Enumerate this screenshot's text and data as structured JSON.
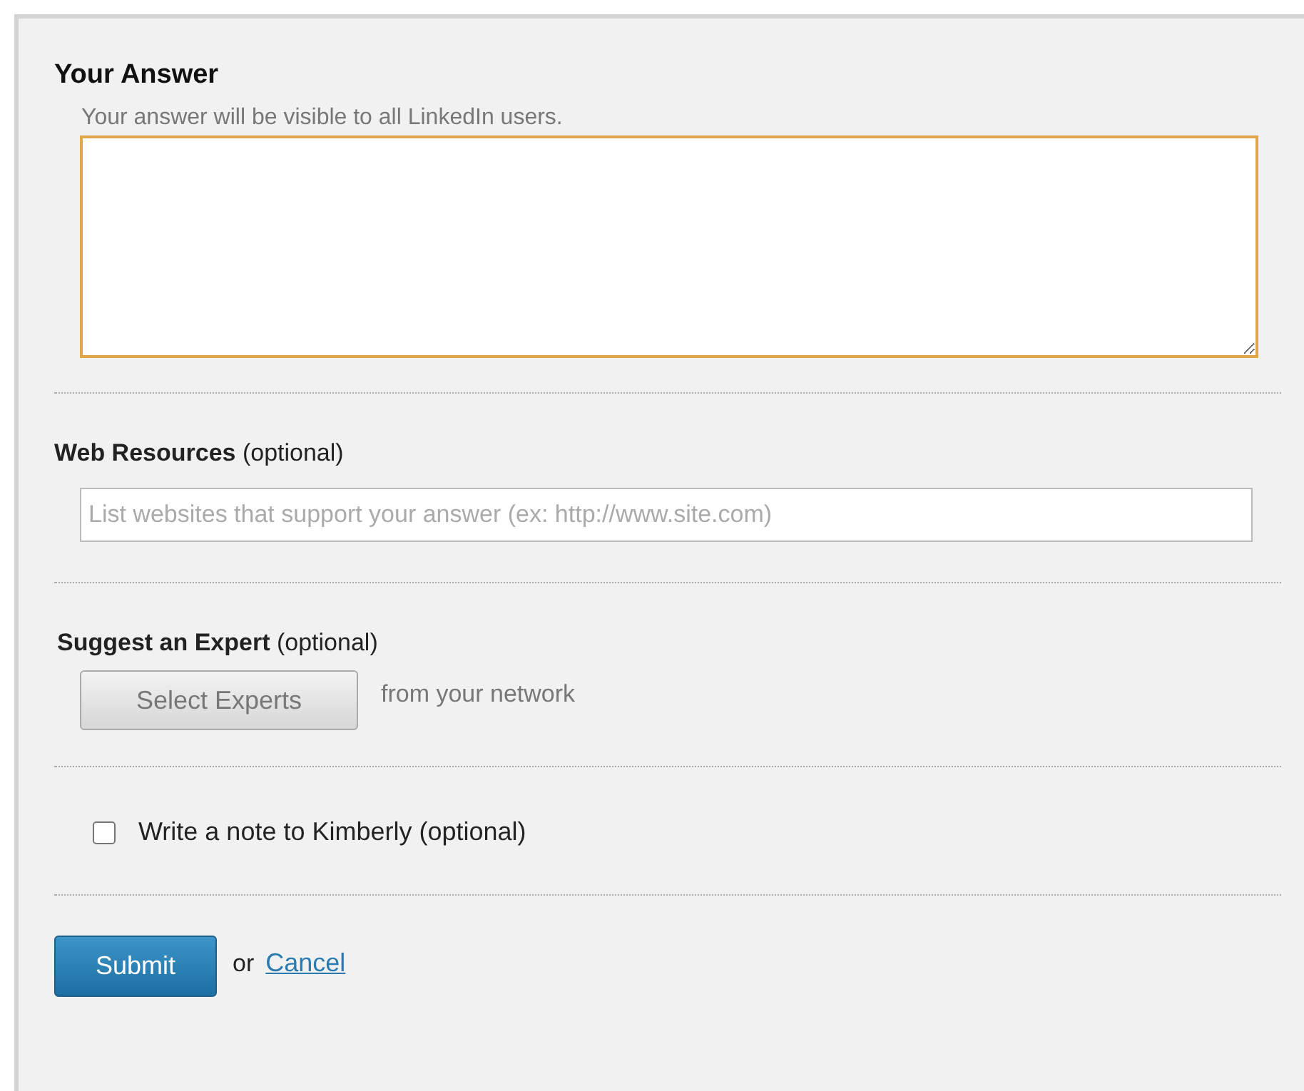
{
  "answer": {
    "title": "Your Answer",
    "hint": "Your answer will be visible to all LinkedIn users.",
    "focused": true
  },
  "resources": {
    "title": "**Web Resources** (optional)",
    "placeholder": "List websites that support your answer (ex: http://www.site.com)"
  },
  "expert": {
    "title": "**Suggest an Expert** (optional)",
    "button": "Select Experts",
    "note": "from your network"
  },
  "note_option": {
    "label": "Write a note to Kimberly (optional)",
    "checked": false
  },
  "actions": {
    "submit": "Submit",
    "or": "or",
    "cancel": "Cancel"
  }
}
